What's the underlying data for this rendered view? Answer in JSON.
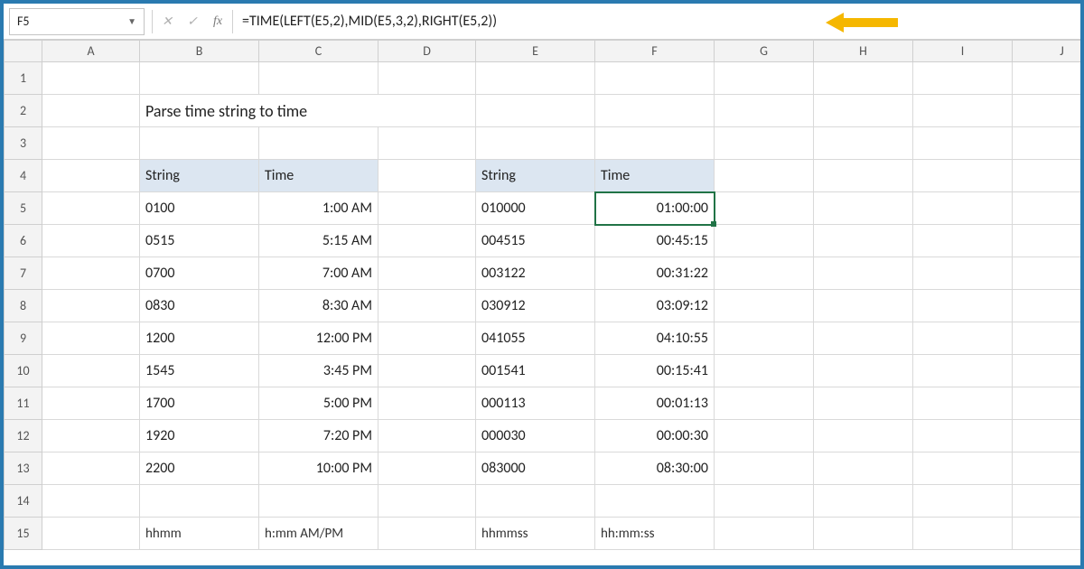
{
  "name_box": "F5",
  "formula": "=TIME(LEFT(E5,2),MID(E5,3,2),RIGHT(E5,2))",
  "icons": {
    "fx": "fx",
    "cancel": "✕",
    "enter": "✓",
    "dropdown": "▼"
  },
  "title": "Parse time string to time",
  "columns": [
    "A",
    "B",
    "C",
    "D",
    "E",
    "F",
    "G",
    "H",
    "I",
    "J"
  ],
  "rows": [
    "1",
    "2",
    "3",
    "4",
    "5",
    "6",
    "7",
    "8",
    "9",
    "10",
    "11",
    "12",
    "13",
    "14",
    "15"
  ],
  "table1": {
    "headers": {
      "string": "String",
      "time": "Time"
    },
    "rows": [
      {
        "s": "0100",
        "t": "1:00 AM"
      },
      {
        "s": "0515",
        "t": "5:15 AM"
      },
      {
        "s": "0700",
        "t": "7:00 AM"
      },
      {
        "s": "0830",
        "t": "8:30 AM"
      },
      {
        "s": "1200",
        "t": "12:00 PM"
      },
      {
        "s": "1545",
        "t": "3:45 PM"
      },
      {
        "s": "1700",
        "t": "5:00 PM"
      },
      {
        "s": "1920",
        "t": "7:20 PM"
      },
      {
        "s": "2200",
        "t": "10:00 PM"
      }
    ],
    "format": {
      "s": "hhmm",
      "t": "h:mm AM/PM"
    }
  },
  "table2": {
    "headers": {
      "string": "String",
      "time": "Time"
    },
    "rows": [
      {
        "s": "010000",
        "t": "01:00:00"
      },
      {
        "s": "004515",
        "t": "00:45:15"
      },
      {
        "s": "003122",
        "t": "00:31:22"
      },
      {
        "s": "030912",
        "t": "03:09:12"
      },
      {
        "s": "041055",
        "t": "04:10:55"
      },
      {
        "s": "001541",
        "t": "00:15:41"
      },
      {
        "s": "000113",
        "t": "00:01:13"
      },
      {
        "s": "000030",
        "t": "00:00:30"
      },
      {
        "s": "083000",
        "t": "08:30:00"
      }
    ],
    "format": {
      "s": "hhmmss",
      "t": "hh:mm:ss"
    }
  },
  "colors": {
    "arrow": "#f5b700"
  }
}
